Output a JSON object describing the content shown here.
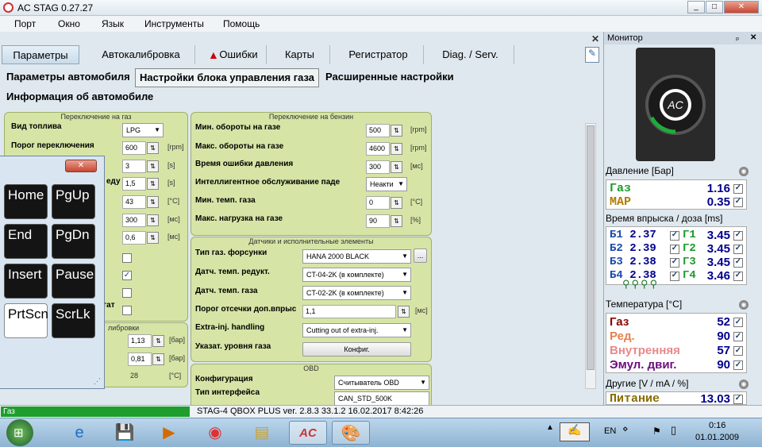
{
  "window": {
    "title": "AC STAG 0.27.27",
    "btn_min": "_",
    "btn_max": "□",
    "btn_close": "✕"
  },
  "menu": [
    "Порт",
    "Окно",
    "Язык",
    "Инструменты",
    "Помощь"
  ],
  "tabs": [
    "Параметры",
    "Автокалибровка",
    "Ошибки",
    "Карты",
    "Регистратор",
    "Diag. / Serv."
  ],
  "subtabs": [
    "Параметры автомобиля",
    "Настройки блока управления газа",
    "Расширенные настройки",
    "Информация об автомобиле"
  ],
  "panel_gas": {
    "head": "Переключение на газ",
    "fuel_label": "Вид топлива",
    "fuel_value": "LPG",
    "threshold_label": "Порог переключения",
    "threshold_value": "600",
    "threshold_unit": "[rpm]",
    "v2": "3",
    "u2": "[s]",
    "v3": "1,5",
    "u3": "[s]",
    "v4": "43",
    "u4": "[°C]",
    "v5": "300",
    "u5": "[мс]",
    "v6": "0,6",
    "u6": "[мс]",
    "partial_reduct": "еду",
    "partial_gat": "гат"
  },
  "panel_calib": {
    "head": "либровки",
    "v1": "1,13",
    "u1": "[бар]",
    "v2": "0,81",
    "u2": "[бар]",
    "v3": "28",
    "u3": "[°C]"
  },
  "panel_petrol": {
    "head": "Переключение на бензин",
    "r1": "Мин. обороты на газе",
    "v1": "500",
    "u1": "[rpm]",
    "r2": "Макс. обороты на газе",
    "v2": "4600",
    "u2": "[rpm]",
    "r3": "Время ошибки давления",
    "v3": "300",
    "u3": "[мс]",
    "r4": "Интеллигентное обслуживание паде",
    "v4": "Неакти",
    "r5": "Мин. темп. газа",
    "v5": "0",
    "u5": "[°C]",
    "r6": "Макс. нагрузка на газе",
    "v6": "90",
    "u6": "[%]"
  },
  "panel_sensors": {
    "head": "Датчики и исполнительные элементы",
    "r1": "Тип газ. форсунки",
    "v1": "HANA 2000 BLACK",
    "r2": "Датч. темп. редукт.",
    "v2": "CT-04-2K (в комплекте)",
    "r3": "Датч. темп. газа",
    "v3": "CT-02-2K (в комплекте)",
    "r4": "Порог отсечки доп.впрыс",
    "v4": "1,1",
    "u4": "[мс]",
    "r5": "Extra-inj. handling",
    "v5": "Cutting out of extra-inj.",
    "r6": "Указат. уровня газа",
    "btn6": "Конфиг.",
    "dots": "..."
  },
  "panel_obd": {
    "head": "OBD",
    "r1": "Конфигурация",
    "v1": "Считыватель OBD",
    "r2": "Тип интерфейса",
    "v2": "CAN_STD_500K"
  },
  "keyboard": {
    "keys": [
      "Home",
      "PgUp",
      "End",
      "PgDn",
      "Insert",
      "Pause",
      "PrtScn",
      "ScrLk"
    ],
    "close": "✕"
  },
  "monitor": {
    "title": "Монитор",
    "pin": "ₚ",
    "close": "✕",
    "pressure_title": "Давление [Бар]",
    "gas_label": "Газ",
    "gas_value": "1.16",
    "map_label": "MAP",
    "map_value": "0.35",
    "inj_title": "Время впрыска / доза [ms]",
    "inj": [
      [
        "Б1",
        "2.37",
        "Г1",
        "3.45"
      ],
      [
        "Б2",
        "2.39",
        "Г2",
        "3.45"
      ],
      [
        "Б3",
        "2.38",
        "Г3",
        "3.45"
      ],
      [
        "Б4",
        "2.38",
        "Г4",
        "3.46"
      ]
    ],
    "temp_title": "Температура [°C]",
    "temps": [
      [
        "Газ",
        "52",
        "#8b0000"
      ],
      [
        "Ред.",
        "90",
        "#e5824e"
      ],
      [
        "Внутренняя",
        "57",
        "#e8898b"
      ],
      [
        "Эмул. двиг.",
        "90",
        "#6b0d80"
      ]
    ],
    "other_title": "Другие [V / mA / %]",
    "supply_label": "Питание",
    "supply_value": "13.03"
  },
  "status": {
    "fuel": "Газ",
    "device": "STAG-4 QBOX PLUS  ver. 2.8.3  33.1.2  16.02.2017 8:42:26"
  },
  "taskbar": {
    "lang": "EN",
    "time": "0:16",
    "date": "01.01.2009"
  }
}
